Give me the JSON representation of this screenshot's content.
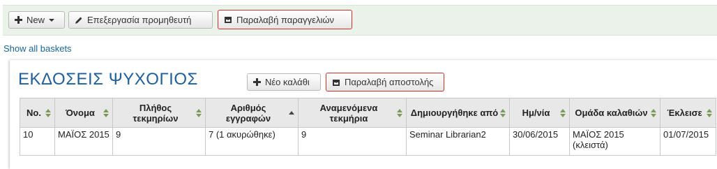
{
  "toolbar": {
    "new_label": "New",
    "edit_vendor_label": "Επεξεργασία προμηθευτή",
    "receive_orders_label": "Παραλαβή παραγγελιών"
  },
  "show_all_baskets": "Show all baskets",
  "vendor": {
    "name": "ΕΚΔΟΣΕΙΣ ΨΥΧΟΓΙΟΣ",
    "new_basket_label": "Νέο καλάθι",
    "receive_shipment_label": "Παραλαβή αποστολής"
  },
  "table": {
    "headers": [
      "No.",
      "Όνομα",
      "Πλήθος τεκμηρίων",
      "Αριθμός εγγραφών",
      "Αναμενόμενα τεκμήρια",
      "Δημιουργήθηκε από",
      "Ημ/νία",
      "Ομάδα καλαθιών",
      "Έκλεισε"
    ],
    "rows": [
      [
        "10",
        "ΜΑΪΟΣ 2015",
        "9",
        "7 (1 ακυρώθηκε)",
        "9",
        "Seminar Librarian2",
        "30/06/2015",
        "ΜΑΪΟΣ 2015 (κλειστά)",
        "01/07/2015"
      ]
    ]
  }
}
